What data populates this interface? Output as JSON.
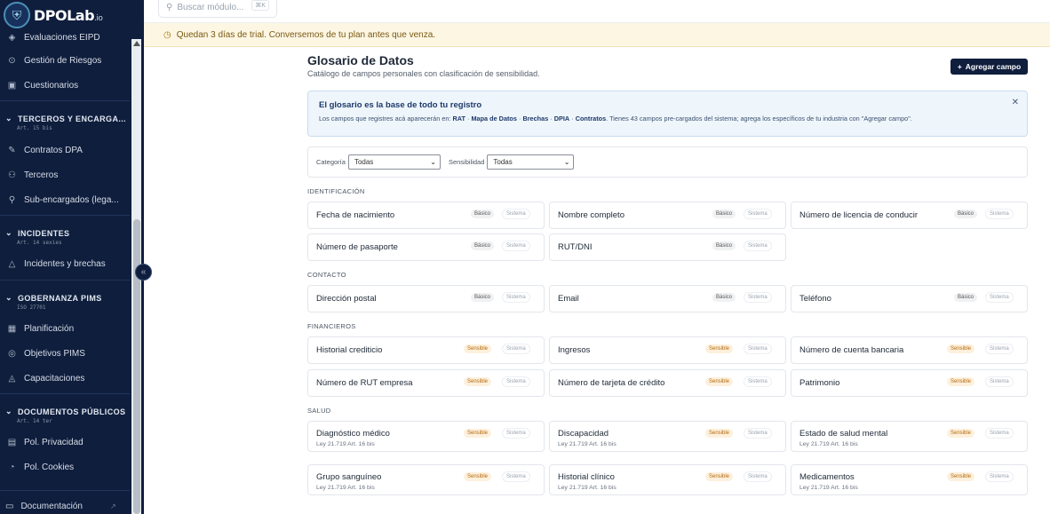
{
  "brand": {
    "name": "DPOLab",
    "suffix": ".io"
  },
  "search": {
    "placeholder": "Buscar módulo...",
    "shortcut": "⌘K"
  },
  "trial": {
    "text": "Quedan 3 días de trial. Conversemos de tu plan antes que venza."
  },
  "sidebar": {
    "items": [
      {
        "label": "Evaluaciones EIPD",
        "icon": "shield-icon"
      },
      {
        "label": "Gestión de Riesgos",
        "icon": "risk-icon"
      },
      {
        "label": "Cuestionarios",
        "icon": "clipboard-icon"
      },
      {
        "label": "Contratos DPA",
        "icon": "contract-icon"
      },
      {
        "label": "Terceros",
        "icon": "users-icon"
      },
      {
        "label": "Sub-encargados (lega...",
        "icon": "network-icon"
      },
      {
        "label": "Incidentes y brechas",
        "icon": "warning-icon"
      },
      {
        "label": "Planificación",
        "icon": "calendar-icon"
      },
      {
        "label": "Objetivos PIMS",
        "icon": "target-icon"
      },
      {
        "label": "Capacitaciones",
        "icon": "graduation-icon"
      },
      {
        "label": "Pol. Privacidad",
        "icon": "document-icon"
      },
      {
        "label": "Pol. Cookies",
        "icon": "cookie-icon"
      }
    ],
    "sections": [
      {
        "title": "TERCEROS Y ENCARGA...",
        "sub": "Art. 15 bis"
      },
      {
        "title": "INCIDENTES",
        "sub": "Art. 14 sexies"
      },
      {
        "title": "GOBERNANZA PIMS",
        "sub": "ISO 27701"
      },
      {
        "title": "DOCUMENTOS PÚBLICOS",
        "sub": "Art. 14 ter"
      }
    ],
    "footer": {
      "label": "Documentación"
    }
  },
  "page": {
    "title": "Glosario de Datos",
    "subtitle": "Catálogo de campos personales con clasificación de sensibilidad.",
    "add_button": "Agregar campo"
  },
  "info": {
    "title": "El glosario es la base de todo tu registro",
    "prefix": "Los campos que registres acá aparecerán en: ",
    "links": [
      "RAT",
      "Mapa de Datos",
      "Brechas",
      "DPIA",
      "Contratos"
    ],
    "suffix": ". Tienes 43 campos pre-cargados del sistema; agrega los específicos de tu industria con \"Agregar campo\"."
  },
  "filters": {
    "category_label": "Categoría",
    "category_value": "Todas",
    "sensitivity_label": "Sensibilidad",
    "sensitivity_value": "Todas"
  },
  "groups": [
    {
      "name": "IDENTIFICACIÓN",
      "fields": [
        {
          "name": "Fecha de nacimiento",
          "level": "Básico",
          "source": "Sistema"
        },
        {
          "name": "Nombre completo",
          "level": "Básico",
          "source": "Sistema"
        },
        {
          "name": "Número de licencia de conducir",
          "level": "Básico",
          "source": "Sistema"
        },
        {
          "name": "Número de pasaporte",
          "level": "Básico",
          "source": "Sistema"
        },
        {
          "name": "RUT/DNI",
          "level": "Básico",
          "source": "Sistema"
        }
      ]
    },
    {
      "name": "CONTACTO",
      "fields": [
        {
          "name": "Dirección postal",
          "level": "Básico",
          "source": "Sistema"
        },
        {
          "name": "Email",
          "level": "Básico",
          "source": "Sistema"
        },
        {
          "name": "Teléfono",
          "level": "Básico",
          "source": "Sistema"
        }
      ]
    },
    {
      "name": "FINANCIEROS",
      "fields": [
        {
          "name": "Historial crediticio",
          "level": "Sensible",
          "source": "Sistema"
        },
        {
          "name": "Ingresos",
          "level": "Sensible",
          "source": "Sistema"
        },
        {
          "name": "Número de cuenta bancaria",
          "level": "Sensible",
          "source": "Sistema"
        },
        {
          "name": "Número de RUT empresa",
          "level": "Sensible",
          "source": "Sistema"
        },
        {
          "name": "Número de tarjeta de crédito",
          "level": "Sensible",
          "source": "Sistema"
        },
        {
          "name": "Patrimonio",
          "level": "Sensible",
          "source": "Sistema"
        }
      ]
    },
    {
      "name": "SALUD",
      "fields": [
        {
          "name": "Diagnóstico médico",
          "level": "Sensible",
          "source": "Sistema",
          "law": "Ley 21.719 Art. 16 bis"
        },
        {
          "name": "Discapacidad",
          "level": "Sensible",
          "source": "Sistema",
          "law": "Ley 21.719 Art. 16 bis"
        },
        {
          "name": "Estado de salud mental",
          "level": "Sensible",
          "source": "Sistema",
          "law": "Ley 21.719 Art. 16 bis"
        },
        {
          "name": "Grupo sanguíneo",
          "level": "Sensible",
          "source": "Sistema",
          "law": "Ley 21.719 Art. 16 bis"
        },
        {
          "name": "Historial clínico",
          "level": "Sensible",
          "source": "Sistema",
          "law": "Ley 21.719 Art. 16 bis"
        },
        {
          "name": "Medicamentos",
          "level": "Sensible",
          "source": "Sistema",
          "law": "Ley 21.719 Art. 16 bis"
        }
      ]
    }
  ]
}
